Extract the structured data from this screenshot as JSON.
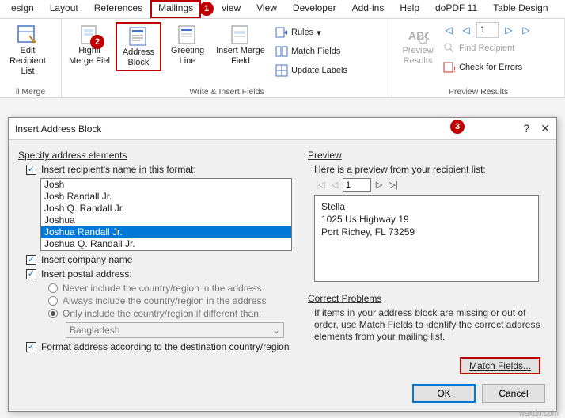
{
  "tabs": [
    "esign",
    "Layout",
    "References",
    "Mailings",
    "view",
    "View",
    "Developer",
    "Add-ins",
    "Help",
    "doPDF 11",
    "Table Design"
  ],
  "badges": {
    "b1": "1",
    "b2": "2",
    "b3": "3"
  },
  "ribbon": {
    "edit_recipient": "Edit\nRecipient List",
    "highlight": "Highli\nMerge Fiel",
    "address_block": "Address\nBlock",
    "greeting": "Greeting\nLine",
    "insert_merge": "Insert Merge\nField",
    "rules": "Rules",
    "match_fields": "Match Fields",
    "update_labels": "Update Labels",
    "preview_results": "Preview\nResults",
    "find_recipient": "Find Recipient",
    "check_errors": "Check for Errors",
    "nav_value": "1",
    "group_mailmerge": "il Merge",
    "group_write": "Write & Insert Fields",
    "group_preview": "Preview Results"
  },
  "dialog": {
    "title": "Insert Address Block",
    "specify_head": "Specify address elements",
    "insert_name": "Insert recipient's name in this format:",
    "name_options": [
      "Josh",
      "Josh Randall Jr.",
      "Josh Q. Randall Jr.",
      "Joshua",
      "Joshua Randall Jr.",
      "Joshua Q. Randall Jr."
    ],
    "insert_company": "Insert company name",
    "insert_postal": "Insert postal address:",
    "radio_never": "Never include the country/region in the address",
    "radio_always": "Always include the country/region in the address",
    "radio_only": "Only include the country/region if different than:",
    "country": "Bangladesh",
    "format_dest": "Format address according to the destination country/region",
    "preview_head": "Preview",
    "preview_hint": "Here is a preview from your recipient list:",
    "nav_value": "1",
    "preview_text": {
      "l1": "Stella",
      "l2": "1025 Us Highway 19",
      "l3": "Port Richey, FL 73259"
    },
    "correct_head": "Correct Problems",
    "correct_text": "If items in your address block are missing or out of order, use Match Fields to identify the correct address elements from your mailing list.",
    "match_btn": "Match Fields...",
    "ok": "OK",
    "cancel": "Cancel"
  },
  "watermark": "wsxdn.com"
}
